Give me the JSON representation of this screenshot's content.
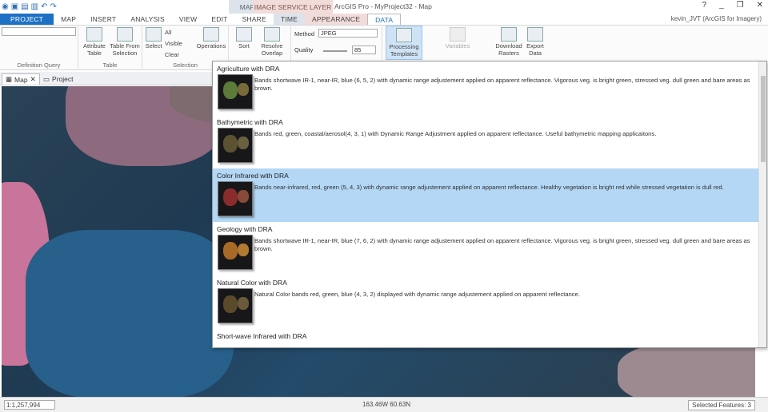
{
  "window": {
    "title": "ArcGIS Pro - MyProject32 - Map"
  },
  "contextual_groups": {
    "map": "MAP",
    "image_service_layer": "IMAGE SERVICE LAYER"
  },
  "tabs": [
    "PROJECT",
    "MAP",
    "INSERT",
    "ANALYSIS",
    "VIEW",
    "EDIT",
    "SHARE",
    "TIME",
    "APPEARANCE",
    "DATA"
  ],
  "user": "kevin_JVT (ArcGIS for Imagery)",
  "ribbon": {
    "groups": {
      "definition_query": "Definition Query",
      "table": "Table",
      "selection": "Selection"
    },
    "attribute_table": "Attribute Table",
    "table_from_selection": "Table From Selection",
    "select": "Select",
    "all": "All",
    "visible": "Visible",
    "clear": "Clear",
    "operations": "Operations",
    "sort": "Sort",
    "resolve_overlap": "Resolve Overlap",
    "method_label": "Method",
    "method_value": "JPEG",
    "quality_label": "Quality",
    "quality_value": "85",
    "processing_templates": "Processing Templates",
    "variables": "Variables",
    "download_rasters": "Download Rasters",
    "export_data": "Export Data"
  },
  "doc_tabs": {
    "map": "Map",
    "project": "Project"
  },
  "templates": [
    {
      "name": "Agriculture with DRA",
      "desc": "Bands shortwave IR-1, near-IR, blue (6, 5, 2) with dynamic range adjustement applied on apparent reflectance. Vigorous veg. is bright green, stressed veg. dull green and bare areas as brown."
    },
    {
      "name": "Bathymetric with DRA",
      "desc": "Bands red, green, coastal/aerosol(4, 3, 1) with Dynamic Range Adjustment applied on apparent reflectance. Useful bathymetric mapping applicaitons."
    },
    {
      "name": "Color Infrared with DRA",
      "desc": "Bands near-infrared, red, green (5, 4, 3) with dynamic range adjustement applied on apparent reflectance. Healthy vegetation is bright red while stressed vegetation is dull red."
    },
    {
      "name": "Geology with DRA",
      "desc": "Bands shortwave IR-1, near-IR, blue (7, 6, 2) with dynamic range adjustement applied on apparent reflectance. Vigorous veg. is bright green, stressed veg. dull green and bare areas as brown."
    },
    {
      "name": "Natural Color with DRA",
      "desc": "Natural Color bands red, green, blue (4, 3, 2) displayed with dynamic range adjustement applied on apparent reflectance."
    },
    {
      "name": "Short-wave Infrared with DRA",
      "desc": ""
    }
  ],
  "status": {
    "scale": "1:1,257,994",
    "coords": "163.46W 60.63N",
    "selected_features": "Selected Features: 3"
  },
  "colors": {
    "accent": "#1d71c4",
    "selected_row": "#b3d7f5"
  }
}
